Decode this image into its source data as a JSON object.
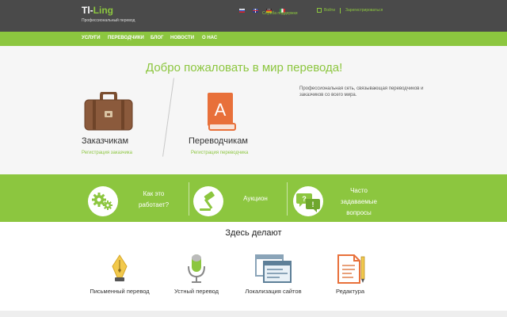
{
  "header": {
    "logo_main": "Tl-",
    "logo_accent": "Ling",
    "tagline": "Профессиональный перевод",
    "languages": [
      {
        "code": "ru",
        "icon": "flag-ru-icon"
      },
      {
        "code": "en",
        "icon": "flag-en-icon"
      },
      {
        "code": "de",
        "icon": "flag-de-icon"
      },
      {
        "code": "it",
        "icon": "flag-it-icon"
      }
    ],
    "support_label": "Служба поддержки",
    "login_label": "Войти",
    "register_label": "Зарегистрироваться",
    "colors": {
      "bar": "#4a4a4a",
      "accent": "#8cc63f"
    }
  },
  "nav": {
    "items": [
      "Услуги",
      "Переводчики",
      "Блог",
      "Новости",
      "О нас"
    ]
  },
  "hero": {
    "title": "Добро пожаловать в мир перевода!",
    "description": "Профессиональная сеть, связывающая переводчиков и заказчиков со всего мира.",
    "customers": {
      "title": "Заказчикам",
      "link": "Регистрация заказчика",
      "icon": "briefcase-icon"
    },
    "translators": {
      "title": "Переводчикам",
      "link": "Регистрация переводчика",
      "icon": "book-icon"
    }
  },
  "features": [
    {
      "label_line1": "Как это",
      "label_line2": "работает?",
      "label_line3": "",
      "icon": "gears-icon"
    },
    {
      "label_line1": "Аукцион",
      "label_line2": "",
      "label_line3": "",
      "icon": "gavel-icon"
    },
    {
      "label_line1": "Часто",
      "label_line2": "задаваемые",
      "label_line3": "вопросы",
      "icon": "speech-bubbles-icon"
    }
  ],
  "services": {
    "title": "Здесь делают",
    "items": [
      {
        "label": "Письменный перевод",
        "icon": "fountain-pen-icon"
      },
      {
        "label": "Устный перевод",
        "icon": "microphone-icon"
      },
      {
        "label": "Локализация сайтов",
        "icon": "browser-window-icon"
      },
      {
        "label": "Редактура",
        "icon": "document-pencil-icon"
      }
    ]
  }
}
